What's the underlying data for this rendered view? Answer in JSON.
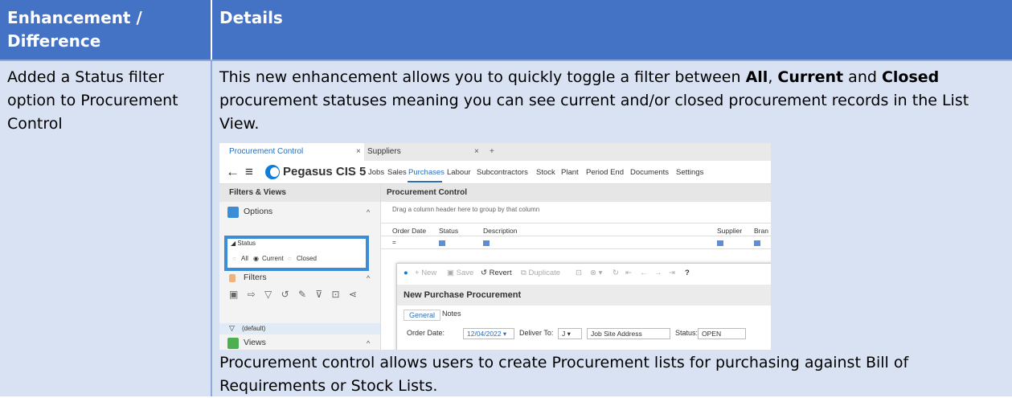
{
  "table": {
    "header": {
      "col1": "Enhancement / Difference",
      "col2": "Details"
    },
    "row": {
      "title": "Added a Status filter option to Procurement Control",
      "para1_prefix": "This new enhancement allows you to quickly toggle a filter between ",
      "para1_all": "All",
      "para1_sep1": ", ",
      "para1_current": "Current",
      "para1_and": " and ",
      "para1_closed": "Closed",
      "para1_suffix": " procurement statuses meaning you can see current and/or closed procurement records in the List View.",
      "para2": "Procurement control allows users to create Procurement lists for purchasing against Bill of Requirements or Stock Lists."
    }
  },
  "screenshot": {
    "tabs": [
      {
        "label": "Procurement Control",
        "close": "×"
      },
      {
        "label": "Suppliers",
        "close": "×",
        "plus": "+"
      }
    ],
    "brand": "Pegasus CIS 5",
    "menu": [
      "Jobs",
      "Sales",
      "Purchases",
      "Labour",
      "Subcontractors",
      "Stock",
      "Plant",
      "Period End",
      "Documents",
      "Settings"
    ],
    "active_menu": "Purchases",
    "left": {
      "header": "Filters & Views",
      "options": "Options",
      "status_label": "◢ Status",
      "status_all": "All",
      "status_current": "Current",
      "status_closed": "Closed",
      "filters": "Filters",
      "default": "(default)",
      "views": "Views"
    },
    "main": {
      "header": "Procurement Control",
      "group_hint": "Drag a column header here to group by that column",
      "columns": [
        "Order Date",
        "Status",
        "Description",
        "Supplier",
        "Bran"
      ],
      "filter_op": "="
    },
    "dialog": {
      "toolbar": {
        "new": "New",
        "save": "Save",
        "revert": "Revert",
        "duplicate": "Duplicate",
        "help": "?"
      },
      "title": "New Purchase Procurement",
      "tabs": [
        "General",
        "Notes"
      ],
      "order_date_label": "Order Date:",
      "order_date": "12/04/2022",
      "deliver_to_label": "Deliver To:",
      "deliver_to": "J",
      "job_site": "Job Site Address",
      "status_label": "Status:",
      "status": "OPEN"
    },
    "colors": {
      "accent": "#2a6ebb",
      "highlight": "#3a8dd6"
    }
  }
}
